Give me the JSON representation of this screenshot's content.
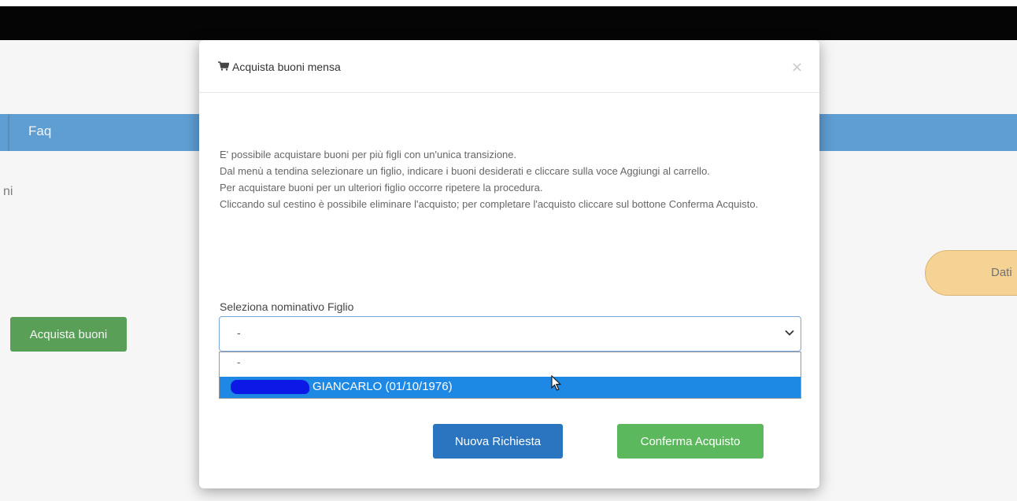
{
  "background": {
    "nav_item": "Faq",
    "partial_text": "ni",
    "buy_button": "Acquista buoni",
    "pill_label": "Dati"
  },
  "modal": {
    "title": "Acquista buoni mensa",
    "close_symbol": "×",
    "instructions": [
      "E' possibile acquistare buoni per più figli con un'unica transizione.",
      "Dal menù a tendina selezionare un figlio, indicare i buoni desiderati e cliccare sulla voce Aggiungi al carrello.",
      "Per acquistare buoni per un ulteriori figlio occorre ripetere la procedura.",
      "Cliccando sul cestino è possibile eliminare l'acquisto; per completare l'acquisto cliccare sul bottone Conferma Acquisto."
    ],
    "select": {
      "label": "Seleziona nominativo Figlio",
      "value": "-",
      "options": [
        "-",
        "GIANCARLO (01/10/1976)"
      ],
      "highlighted_index": 1
    },
    "buttons": {
      "new_request": "Nuova Richiesta",
      "confirm": "Conferma Acquisto"
    }
  },
  "colors": {
    "nav_bar": "#1778c9",
    "buy_button": "#0e7a0d",
    "primary": "#2b74bf",
    "success": "#5cb85c",
    "highlight": "#1e88e5",
    "redaction": "#0b18e6",
    "pill": "#fdc96a"
  },
  "icons": {
    "cart": "cart-icon",
    "close": "close-icon",
    "chevron": "chevron-down-icon",
    "cursor": "cursor-pointer-icon"
  }
}
